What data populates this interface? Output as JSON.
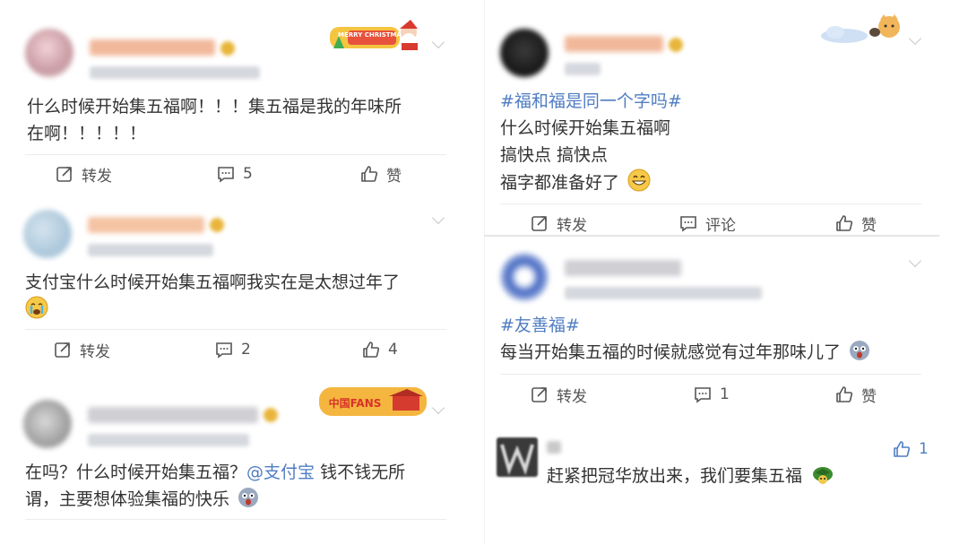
{
  "posts": [
    {
      "text_lines": [
        "什么时候开始集五福啊！！！集五福是我的年味所",
        "在啊！！！！！"
      ],
      "decoration": "MERRY CHRISTMAS",
      "actions": {
        "repost": "转发",
        "comment": "5",
        "like": "赞"
      }
    },
    {
      "text_lines": [
        "支付宝什么时候开始集五福啊我实在是太想过年了"
      ],
      "actions": {
        "repost": "转发",
        "comment": "2",
        "like": "4"
      }
    },
    {
      "text_pre": "在吗？什么时候开始集五福？",
      "mention": "@支付宝",
      "text_post": " 钱不钱无所",
      "text_line2": "谓，主要想体验集福的快乐",
      "decoration": "中国FANS",
      "actions": {
        "repost": "转发",
        "comment": "",
        "like": ""
      }
    },
    {
      "topic": "#福和福是同一个字吗#",
      "text_lines": [
        "什么时候开始集五福啊",
        "搞快点 搞快点",
        "福字都准备好了"
      ],
      "actions": {
        "repost": "转发",
        "comment": "评论",
        "like": "赞"
      }
    },
    {
      "topic": "#友善福#",
      "text_lines": [
        "每当开始集五福的时候就感觉有过年那味儿了"
      ],
      "actions": {
        "repost": "转发",
        "comment": "1",
        "like": "赞"
      }
    },
    {
      "text_lines": [
        "赶紧把冠华放出来，我们要集五福"
      ],
      "like_count": "1"
    }
  ],
  "colors": {
    "topic": "#4f7dc2",
    "text": "#333333",
    "action": "#555555"
  },
  "icons": [
    "repost-icon",
    "comment-icon",
    "like-icon",
    "chevron-down-icon",
    "emoji-grin-icon",
    "emoji-crying-icon",
    "emoji-shocked-icon",
    "emoji-turtle-icon"
  ]
}
